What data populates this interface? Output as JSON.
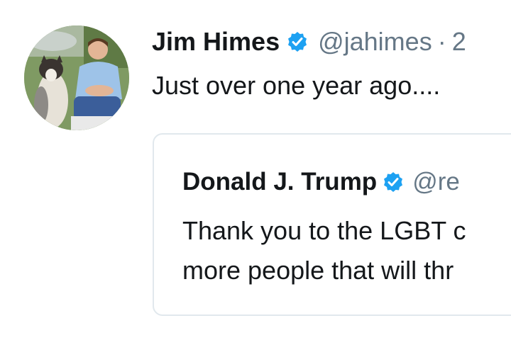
{
  "tweet": {
    "display_name": "Jim Himes",
    "handle": "@jahimes",
    "separator": "·",
    "time": "2",
    "text": "Just over one year ago....",
    "verified_icon": "verified-badge-icon",
    "avatar": "avatar-photo"
  },
  "quoted_tweet": {
    "display_name": "Donald J. Trump",
    "handle": "@re",
    "text_lines": [
      "Thank you to the LGBT c",
      "more people that will thr"
    ],
    "verified_icon": "verified-badge-icon"
  },
  "colors": {
    "text_primary": "#14171a",
    "text_secondary": "#657786",
    "verified_blue": "#1da1f2",
    "card_border": "#e1e8ed"
  }
}
